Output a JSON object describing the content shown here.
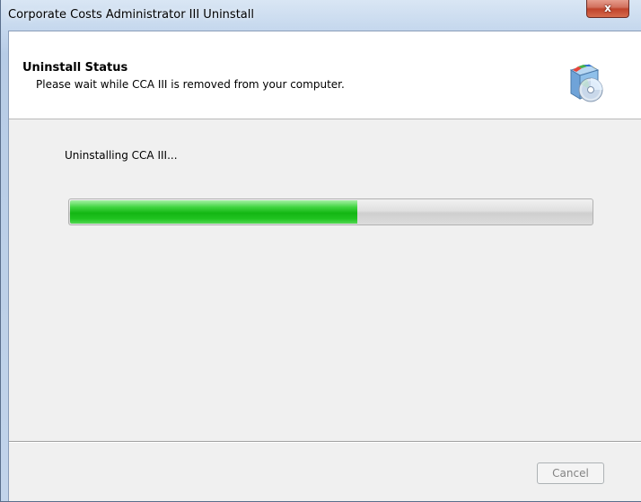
{
  "window": {
    "title": "Corporate Costs Administrator III Uninstall",
    "close_label": "x"
  },
  "header": {
    "title": "Uninstall Status",
    "subtitle": "Please wait while CCA III is removed from your computer.",
    "icon": "installer-disc-icon"
  },
  "main": {
    "status": "Uninstalling CCA III..."
  },
  "progress": {
    "percent": 55
  },
  "buttons": {
    "cancel_label": "Cancel",
    "cancel_enabled": false
  },
  "colors": {
    "progress_green": "#13b613",
    "title_bar": "#c7d9ee",
    "close_red": "#c0432b",
    "panel_bg": "#f0f0f0"
  }
}
